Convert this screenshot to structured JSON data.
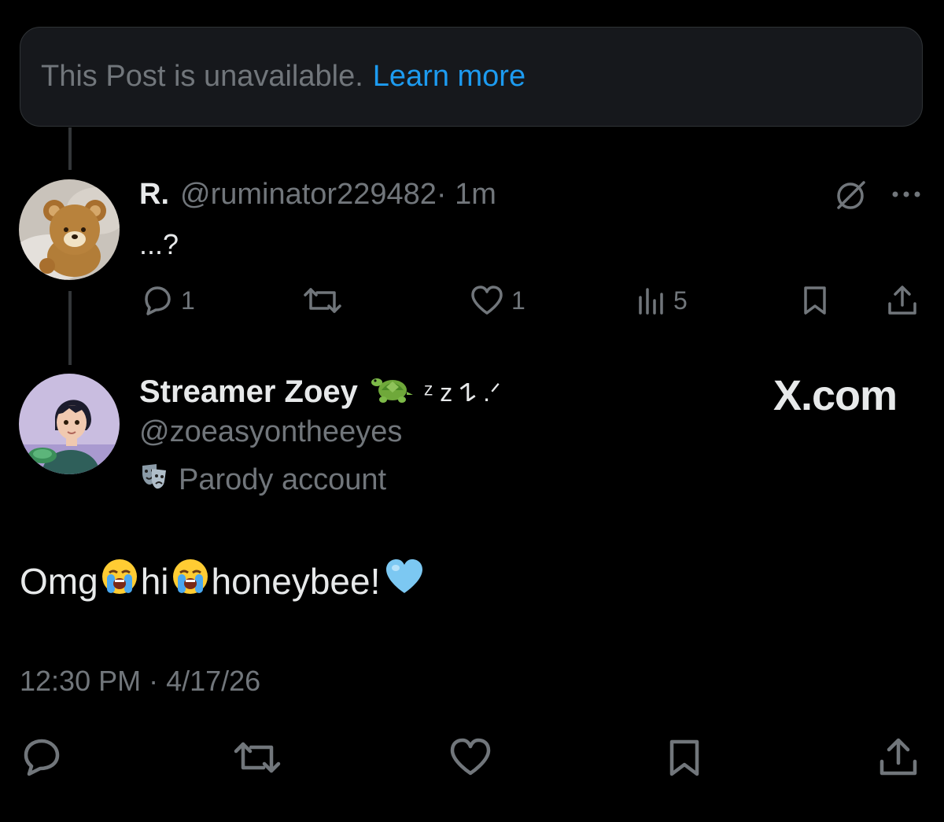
{
  "banner": {
    "message": "This Post is unavailable.",
    "link": "Learn more"
  },
  "reply": {
    "name": "R.",
    "handle": "@ruminator229482",
    "time": " · 1m",
    "text": "...?",
    "actions": {
      "replies": "1",
      "likes": "1",
      "views": "5"
    },
    "icons": [
      "grok-icon",
      "more-icon",
      "reply-icon",
      "repost-icon",
      "like-icon",
      "views-icon",
      "bookmark-icon",
      "share-icon"
    ]
  },
  "post": {
    "author_name": "Streamer Zoey",
    "name_suffix": "ᶻ z 𐰁 .ᐟ",
    "handle": "@zoeasyontheeyes",
    "label": "Parody account",
    "watermark": "X.com",
    "text_parts": [
      "Omg",
      "hi",
      "honeybee!"
    ],
    "emojis": [
      "loudly-crying-face",
      "loudly-crying-face",
      "light-blue-heart",
      "turtle",
      "performing-arts"
    ],
    "timestamp": "12:30 PM · 4/17/26",
    "icons": [
      "reply-icon",
      "repost-icon",
      "like-icon",
      "bookmark-icon",
      "share-icon"
    ]
  },
  "colors": {
    "background": "#000000",
    "text": "#e7e9ea",
    "muted": "#71767b",
    "link": "#1d9bf0",
    "banner_bg": "#16181c",
    "heart": "#7cc8f2"
  }
}
